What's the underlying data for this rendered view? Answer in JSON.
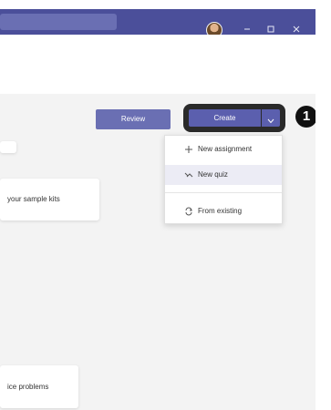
{
  "window": {
    "controls": {
      "minimize_icon": "minimize-icon",
      "maximize_icon": "maximize-icon",
      "close_icon": "close-icon"
    }
  },
  "toolbar": {
    "review_label": "Review",
    "create_label": "Create",
    "create_caret_icon": "chevron-down-icon"
  },
  "callout": {
    "number": "1"
  },
  "create_menu": {
    "items": [
      {
        "icon": "plus-icon",
        "label": "New assignment"
      },
      {
        "icon": "quiz-icon",
        "label": "New quiz"
      },
      {
        "icon": "refresh-icon",
        "label": "From existing"
      }
    ]
  },
  "cards": [
    {
      "text": ""
    },
    {
      "text": "your sample kits"
    },
    {
      "text": "ice problems"
    }
  ],
  "colors": {
    "titlebar": "#4b4f9a",
    "accent": "#5b5fae",
    "review_button": "#6a6fb3",
    "menu_highlight": "#ececf5"
  }
}
